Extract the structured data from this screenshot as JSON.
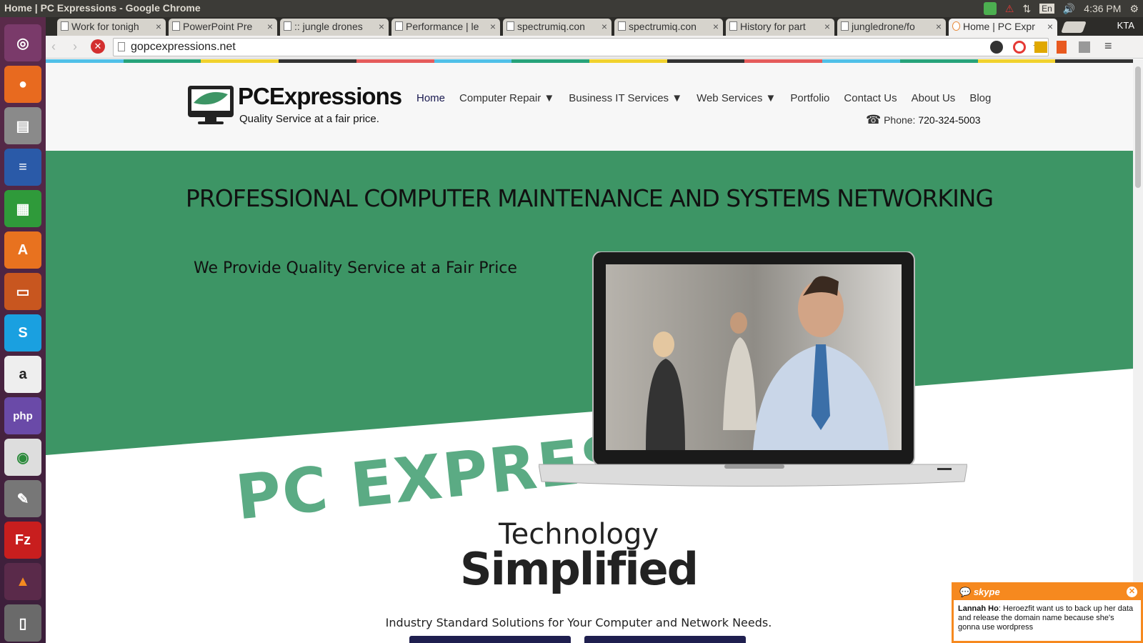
{
  "os": {
    "window_title": "Home | PC Expressions - Google Chrome",
    "clock": "4:36 PM",
    "lang": "En",
    "launcher_icons": [
      "ubuntu-dash-icon",
      "firefox-icon",
      "files-icon",
      "writer-icon",
      "calc-icon",
      "software-center-icon",
      "impress-icon",
      "skype-icon",
      "amazon-icon",
      "phpstorm-icon",
      "chrome-icon",
      "settings-icon",
      "filezilla-icon",
      "vlc-icon",
      "trash-icon"
    ]
  },
  "tabs": [
    {
      "label": "Work for tonigh"
    },
    {
      "label": "PowerPoint Pre"
    },
    {
      "label": ":: jungle drones"
    },
    {
      "label": "Performance | le"
    },
    {
      "label": "spectrumiq.con"
    },
    {
      "label": "spectrumiq.con"
    },
    {
      "label": "History for part"
    },
    {
      "label": "jungledrone/fo"
    },
    {
      "label": "Home | PC Expr"
    }
  ],
  "profile": "KTA",
  "url": "gopcexpressions.net",
  "site": {
    "logo_title": "PCExpressions",
    "logo_tagline": "Quality Service at a fair price.",
    "nav": [
      "Home",
      "Computer Repair",
      "Business IT Services",
      "Web Services",
      "Portfolio",
      "Contact Us",
      "About Us",
      "Blog"
    ],
    "phone_label": "Phone:",
    "phone_number": "720-324-5003",
    "hero_title": "PROFESSIONAL COMPUTER MAINTENANCE AND SYSTEMS NETWORKING",
    "hero_subtitle": "We Provide Quality Service at a Fair Price",
    "watermark": "PC EXPRESS",
    "tech": "Technology",
    "simplified": "Simplified",
    "industry": "Industry Standard Solutions for Your Computer and Network Needs."
  },
  "skype": {
    "brand": "skype",
    "sender": "Lannah Ho",
    "message": ": Heroezfit want us to back up her data and release the domain name because she's gonna use wordpress"
  },
  "colors": {
    "hero_green": "#3d9565",
    "strip": [
      "#50c0e8",
      "#27a37a",
      "#f1d22e",
      "#333333",
      "#e55b5b"
    ]
  }
}
